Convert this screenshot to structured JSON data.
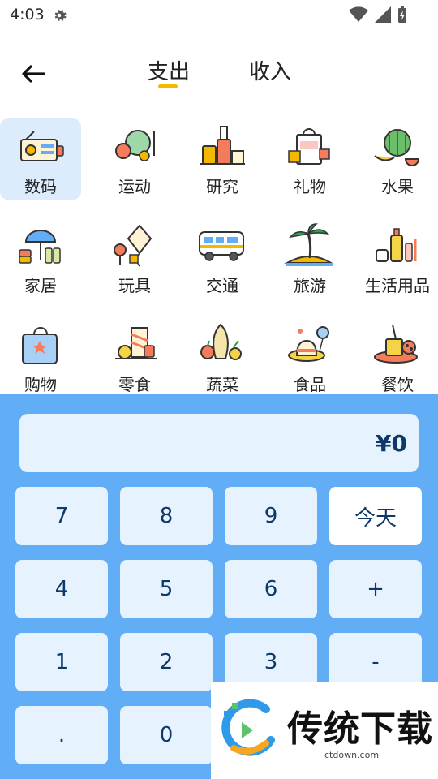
{
  "status": {
    "time": "4:03"
  },
  "header": {
    "tabs": [
      "支出",
      "收入"
    ]
  },
  "categories": [
    {
      "label": "数码",
      "icon": "radio-icon",
      "selected": true
    },
    {
      "label": "运动",
      "icon": "sports-balls-icon"
    },
    {
      "label": "研究",
      "icon": "research-icon"
    },
    {
      "label": "礼物",
      "icon": "gift-bag-icon"
    },
    {
      "label": "水果",
      "icon": "fruit-icon"
    },
    {
      "label": "家居",
      "icon": "home-umbrella-icon"
    },
    {
      "label": "玩具",
      "icon": "kite-toy-icon"
    },
    {
      "label": "交通",
      "icon": "bus-icon"
    },
    {
      "label": "旅游",
      "icon": "palm-island-icon"
    },
    {
      "label": "生活用品",
      "icon": "toiletries-icon"
    },
    {
      "label": "购物",
      "icon": "shopping-bag-icon"
    },
    {
      "label": "零食",
      "icon": "snacks-icon"
    },
    {
      "label": "蔬菜",
      "icon": "vegetables-icon"
    },
    {
      "label": "食品",
      "icon": "food-hat-icon"
    },
    {
      "label": "餐饮",
      "icon": "dining-icon"
    }
  ],
  "keypad": {
    "amount": "¥0",
    "keys": [
      "7",
      "8",
      "9",
      "今天",
      "4",
      "5",
      "6",
      "+",
      "1",
      "2",
      "3",
      "-",
      ".",
      "0"
    ]
  },
  "watermark": {
    "title": "传统下载",
    "url": "ctdown.com"
  },
  "colors": {
    "keypad_bg": "#61aef6",
    "key_bg": "#e6f2fd",
    "accent": "#f5b800",
    "text_dark": "#0d3868"
  }
}
